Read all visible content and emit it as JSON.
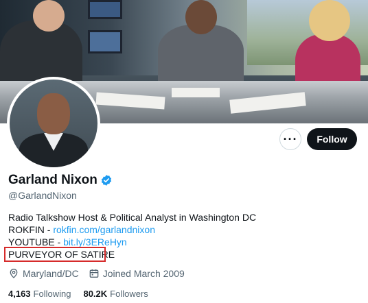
{
  "profile": {
    "name": "Garland Nixon",
    "handle": "@GarlandNixon",
    "bio": {
      "line1": "Radio Talkshow Host & Political Analyst in Washington DC",
      "rokfin_label": "ROKFIN - ",
      "rokfin_link": "rokfin.com/garlandnixon",
      "youtube_label": "YOUTUBE - ",
      "youtube_link": "bit.ly/3EReHyn",
      "satire": "PURVEYOR OF SATIRE"
    },
    "location": "Maryland/DC",
    "joined": "Joined March 2009",
    "following_count": "4,163",
    "following_label": "Following",
    "followers_count": "80.2K",
    "followers_label": "Followers"
  },
  "actions": {
    "more_label": "···",
    "follow_label": "Follow"
  },
  "colors": {
    "accent": "#1d9bf0",
    "text": "#0f1419",
    "muted": "#536471",
    "highlight_box": "#d62b2b"
  },
  "icons": {
    "verified": "verified-badge-icon",
    "location": "location-pin-icon",
    "calendar": "calendar-icon",
    "more": "more-options-icon"
  }
}
